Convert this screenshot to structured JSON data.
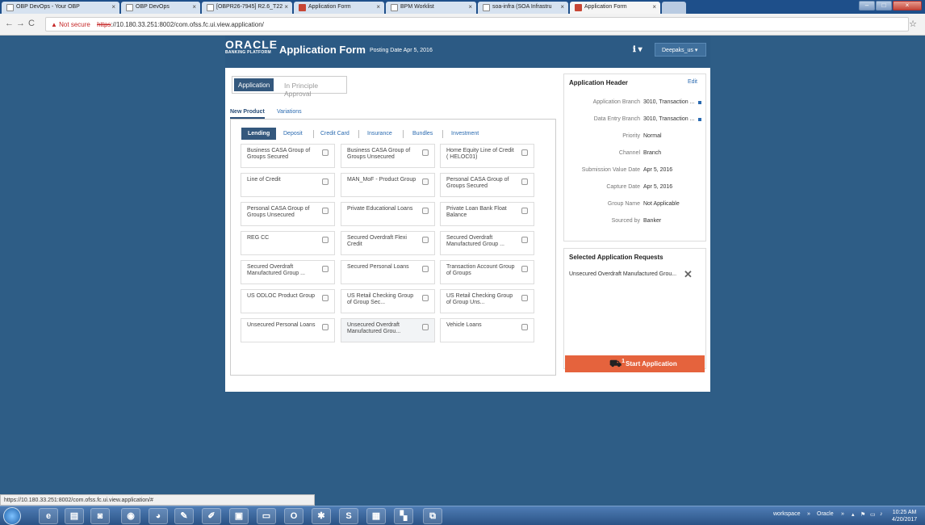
{
  "browser": {
    "tabs": [
      {
        "label": "OBP DevOps - Your OBP",
        "active": false
      },
      {
        "label": "OBP DevOps",
        "active": false
      },
      {
        "label": "[OBPR26-7945] R2.6_T22",
        "active": false
      },
      {
        "label": "Application Form",
        "active": false
      },
      {
        "label": "BPM Worklist",
        "active": false
      },
      {
        "label": "soa-infra (SOA Infrastru",
        "active": false
      },
      {
        "label": "Application Form",
        "active": true
      }
    ],
    "not_secure": "Not secure",
    "url_scheme": "https",
    "url_rest": "://10.180.33.251:8002/com.ofss.fc.ui.view.application/",
    "status_url": "https://10.180.33.251:8002/com.ofss.fc.ui.view.application/#"
  },
  "app": {
    "logo_main": "ORACLE",
    "logo_sub": "BANKING PLATFORM",
    "title": "Application Form",
    "posting_date": "Posting Date  Apr 5, 2016",
    "user": "Deepaks_us",
    "toggle": {
      "selected": "Application",
      "other": "In Principle Approval"
    },
    "subtabs": [
      "New Product",
      "Variations"
    ],
    "categories": [
      "Lending",
      "Deposit",
      "Credit Card",
      "Insurance",
      "Bundles",
      "Investment"
    ],
    "products": [
      "Business CASA Group of Groups Secured",
      "Business CASA Group of Groups Unsecured",
      "Home Equity Line of Credit ( HELOC01)",
      "Line of Credit",
      "MAN_MoF - Product Group",
      "Personal CASA Group of Groups Secured",
      "Personal CASA Group of Groups Unsecured",
      "Private Educational Loans",
      "Private Loan Bank Float Balance",
      "REG CC",
      "Secured Overdraft Flexi Credit",
      "Secured Overdraft Manufactured Group ...",
      "Secured Overdraft Manufactured Group ...",
      "Secured Personal Loans",
      "Transaction Account Group of Groups",
      "US ODLOC Product Group",
      "US Retail Checking Group of Group Sec...",
      "US Retail Checking Group of Group Uns...",
      "Unsecured Personal Loans",
      "Unsecured Overdraft Manufactured Grou...",
      "Vehicle Loans"
    ],
    "header_panel": {
      "title": "Application Header",
      "edit": "Edit",
      "rows": [
        {
          "label": "Application Branch",
          "value": "3010, Transaction ..."
        },
        {
          "label": "Data Entry Branch",
          "value": "3010, Transaction ..."
        },
        {
          "label": "Priority",
          "value": "Normal"
        },
        {
          "label": "Channel",
          "value": "Branch"
        },
        {
          "label": "Submission Value Date",
          "value": "Apr 5, 2016"
        },
        {
          "label": "Capture Date",
          "value": "Apr 5, 2016"
        },
        {
          "label": "Group Name",
          "value": "Not Applicable"
        },
        {
          "label": "Sourced by",
          "value": "Banker"
        }
      ]
    },
    "requests": {
      "title": "Selected Application Requests",
      "item": "Unsecured Overdraft Manufactured Grou...",
      "cart_count": "1",
      "start_label": "Start Application"
    }
  },
  "taskbar": {
    "tray_workspace": "workspace",
    "tray_oracle": "Oracle",
    "time": "10:25 AM",
    "date": "4/20/2017"
  }
}
